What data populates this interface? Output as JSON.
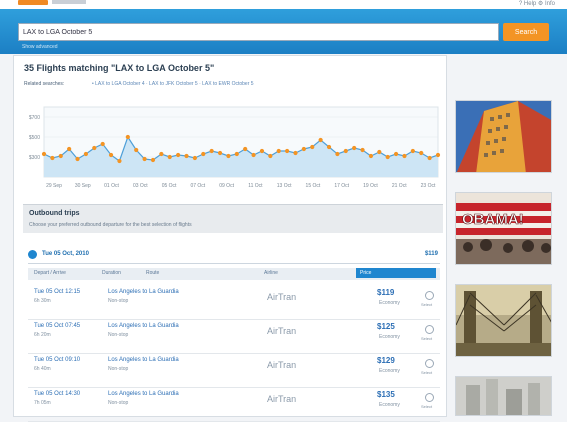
{
  "topbar": {
    "right_text": "? Help  ⚙ Info"
  },
  "search": {
    "value": "LAX to LGA October 5",
    "button": "Search",
    "link": "Show advanced"
  },
  "results": {
    "title": "35 Flights matching \"LAX to LGA October 5\"",
    "subline_label": "Related searches:",
    "subline_links": "• LAX to LGA October 4 · LAX to JFK October 5 · LAX to EWR October 5"
  },
  "chart_data": {
    "type": "area",
    "title": "",
    "xlabel": "",
    "ylabel": "",
    "y_ticks": [
      "$700",
      "$500",
      "$300"
    ],
    "ylim": [
      100,
      800
    ],
    "x_labels": [
      "29 Sep",
      "30 Sep",
      "01 Oct",
      "03 Oct",
      "05 Oct",
      "07 Oct",
      "09 Oct",
      "11 Oct",
      "13 Oct",
      "15 Oct",
      "17 Oct",
      "19 Oct",
      "21 Oct",
      "23 Oct"
    ],
    "values": [
      330,
      290,
      310,
      380,
      280,
      330,
      390,
      430,
      320,
      260,
      500,
      370,
      280,
      270,
      330,
      300,
      320,
      310,
      290,
      330,
      360,
      340,
      310,
      330,
      380,
      320,
      360,
      310,
      360,
      360,
      340,
      380,
      400,
      470,
      400,
      330,
      360,
      390,
      370,
      310,
      350,
      300,
      330,
      310,
      360,
      340,
      290,
      320
    ],
    "colors": {
      "line": "#4e9fd8",
      "fill": "#cde5f5",
      "point": "#f39424"
    }
  },
  "tips": {
    "title": "Outbound trips",
    "text": "Choose your preferred outbound departure for the best selection of flights"
  },
  "group": {
    "date": "Tue 05 Oct, 2010",
    "price": "$119"
  },
  "columns": [
    "Depart / Arrive",
    "Duration",
    "Route",
    "Airline",
    "Price"
  ],
  "rows": [
    {
      "depart": "Tue 05 Oct 12:15",
      "depart_sub": "6h 30m",
      "route": "Los Angeles to La Guardia",
      "route_sub": "Non-stop",
      "airline": "AirTran",
      "price": "$119",
      "price_sub": "Economy",
      "icon_label": "Select"
    },
    {
      "depart": "Tue 05 Oct 07:45",
      "depart_sub": "6h 20m",
      "route": "Los Angeles to La Guardia",
      "route_sub": "Non-stop",
      "airline": "AirTran",
      "price": "$125",
      "price_sub": "Economy",
      "icon_label": "Select"
    },
    {
      "depart": "Tue 05 Oct 09:10",
      "depart_sub": "6h 40m",
      "route": "Los Angeles to La Guardia",
      "route_sub": "Non-stop",
      "airline": "AirTran",
      "price": "$129",
      "price_sub": "Economy",
      "icon_label": "Select"
    },
    {
      "depart": "Tue 05 Oct 14:30",
      "depart_sub": "7h 05m",
      "route": "Los Angeles to La Guardia",
      "route_sub": "Non-stop",
      "airline": "AirTran",
      "price": "$135",
      "price_sub": "Economy",
      "icon_label": "Select"
    }
  ],
  "ads": {
    "names": [
      "building-photo",
      "banner-photo",
      "bridge-photo",
      "city-photo"
    ],
    "banner_text": "OBAMA!"
  }
}
